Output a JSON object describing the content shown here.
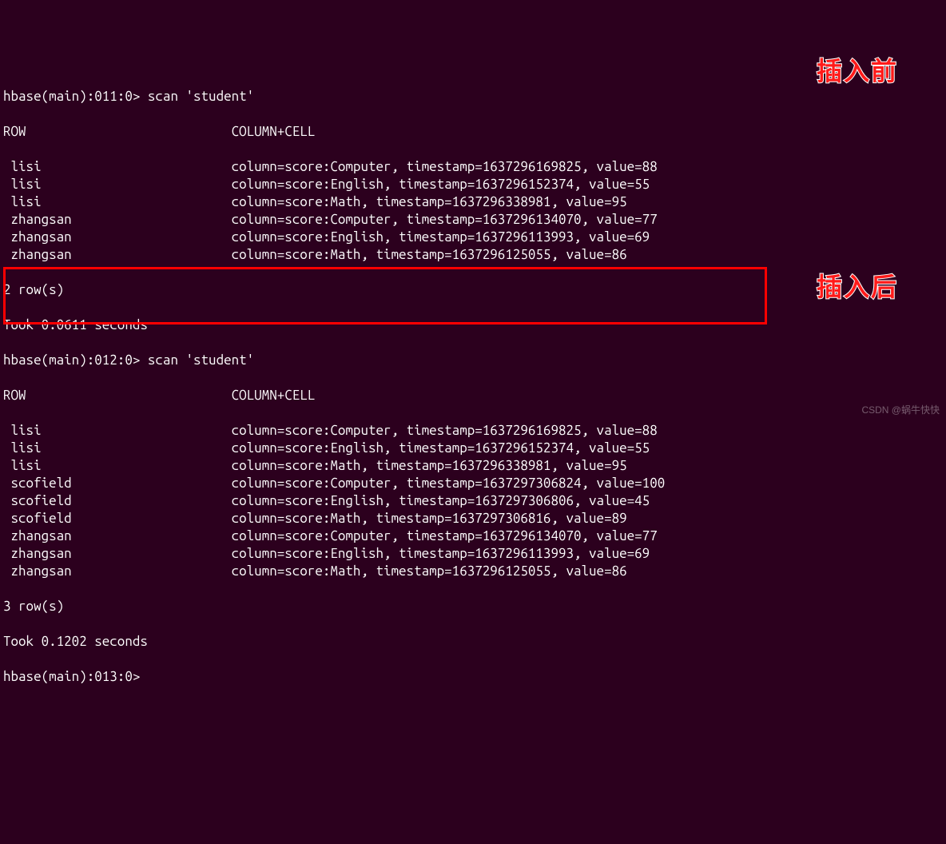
{
  "annotations": {
    "before": "插入前",
    "after": "插入后"
  },
  "watermark": "CSDN @蜗牛快快",
  "scan1": {
    "prompt": "hbase(main):011:0> ",
    "command": "scan 'student'",
    "header_row": "ROW",
    "header_cell": "COLUMN+CELL",
    "rows": [
      {
        "row": "lisi",
        "cell": "column=score:Computer, timestamp=1637296169825, value=88"
      },
      {
        "row": "lisi",
        "cell": "column=score:English, timestamp=1637296152374, value=55"
      },
      {
        "row": "lisi",
        "cell": "column=score:Math, timestamp=1637296338981, value=95"
      },
      {
        "row": "zhangsan",
        "cell": "column=score:Computer, timestamp=1637296134070, value=77"
      },
      {
        "row": "zhangsan",
        "cell": "column=score:English, timestamp=1637296113993, value=69"
      },
      {
        "row": "zhangsan",
        "cell": "column=score:Math, timestamp=1637296125055, value=86"
      }
    ],
    "count": "2 row(s)",
    "took": "Took 0.0611 seconds"
  },
  "scan2": {
    "prompt": "hbase(main):012:0> ",
    "command": "scan 'student'",
    "header_row": "ROW",
    "header_cell": "COLUMN+CELL",
    "rows": [
      {
        "row": "lisi",
        "cell": "column=score:Computer, timestamp=1637296169825, value=88"
      },
      {
        "row": "lisi",
        "cell": "column=score:English, timestamp=1637296152374, value=55"
      },
      {
        "row": "lisi",
        "cell": "column=score:Math, timestamp=1637296338981, value=95"
      },
      {
        "row": "scofield",
        "cell": "column=score:Computer, timestamp=1637297306824, value=100"
      },
      {
        "row": "scofield",
        "cell": "column=score:English, timestamp=1637297306806, value=45"
      },
      {
        "row": "scofield",
        "cell": "column=score:Math, timestamp=1637297306816, value=89"
      },
      {
        "row": "zhangsan",
        "cell": "column=score:Computer, timestamp=1637296134070, value=77"
      },
      {
        "row": "zhangsan",
        "cell": "column=score:English, timestamp=1637296113993, value=69"
      },
      {
        "row": "zhangsan",
        "cell": "column=score:Math, timestamp=1637296125055, value=86"
      }
    ],
    "count": "3 row(s)",
    "took": "Took 0.1202 seconds"
  },
  "next_prompt": "hbase(main):013:0> "
}
